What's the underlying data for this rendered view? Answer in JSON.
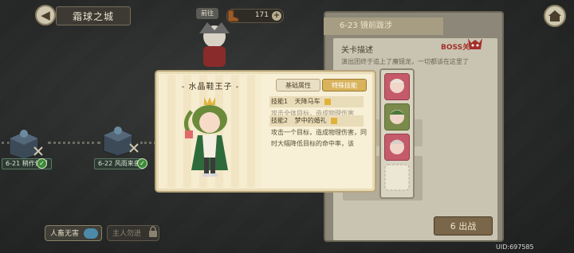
{
  "header": {
    "area_title": "霜球之城",
    "top_badge": "前往",
    "currency_value": "171",
    "currency_plus": "+"
  },
  "map": {
    "nodes": [
      {
        "label": "6-21 稍作停留"
      },
      {
        "label": "6-22 风雨来袭"
      }
    ]
  },
  "bottom_toggles": {
    "toggle1": "人畜无害",
    "toggle2": "主人勿进"
  },
  "stage_panel": {
    "stage_title": "6-23 镜前跋涉",
    "desc_title": "关卡描述",
    "boss_label": "BOSS关",
    "description": "演出团终于追上了魔镜龙，一切都该在这里了",
    "fight_label": "6  出战",
    "fight_cost": "6",
    "fight_text": "出战"
  },
  "popup": {
    "hero_name": "- 水晶鞋王子 -",
    "tab_basic": "基础属性",
    "tab_special": "特殊技能",
    "skills": [
      {
        "label": "技能1",
        "name": "天降马车"
      },
      {
        "label": "技能2",
        "name": "梦中的婚礼"
      }
    ],
    "skill_desc_faded": "攻击全体目标，造成物理伤害",
    "skill_desc": "攻击一个目标，造成物理伤害，同时大幅降低目标的命中率，该"
  },
  "footer": {
    "uid": "UID:697585"
  },
  "colors": {
    "boss_red": "#a3302a",
    "tab_active": "#d9b25c",
    "check_green": "#3f8a3a"
  }
}
